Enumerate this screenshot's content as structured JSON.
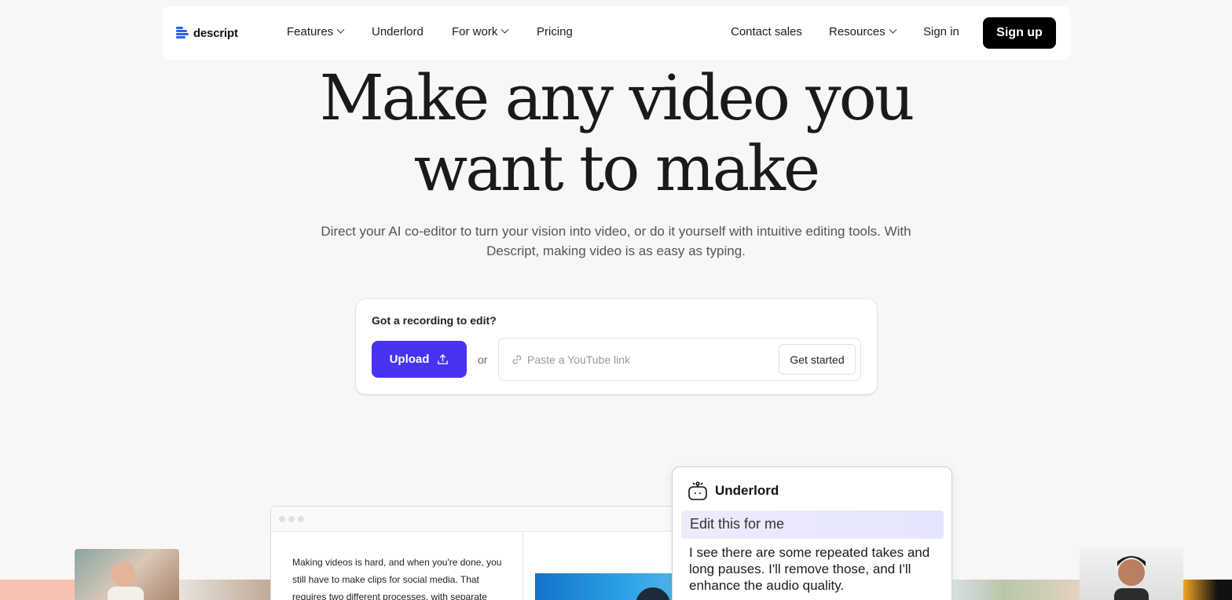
{
  "nav": {
    "brand": "descript",
    "brand_color": "#2862f0",
    "items_left": [
      {
        "label": "Features",
        "has_dropdown": true
      },
      {
        "label": "Underlord",
        "has_dropdown": false
      },
      {
        "label": "For work",
        "has_dropdown": true
      },
      {
        "label": "Pricing",
        "has_dropdown": false
      }
    ],
    "items_right": [
      {
        "label": "Contact sales",
        "has_dropdown": false
      },
      {
        "label": "Resources",
        "has_dropdown": true
      },
      {
        "label": "Sign in",
        "has_dropdown": false
      }
    ],
    "signup_label": "Sign up"
  },
  "hero": {
    "title_line1": "Make any video you",
    "title_line2": "want to make",
    "subtitle": "Direct your AI co-editor to turn your vision into video, or do it yourself with intuitive editing tools. With Descript, making video is as easy as typing."
  },
  "upload_card": {
    "label": "Got a recording to edit?",
    "upload_label": "Upload",
    "or_label": "or",
    "link_placeholder": "Paste a YouTube link",
    "get_started_label": "Get started",
    "accent_color": "#4733f0"
  },
  "showcase": {
    "editor_text": "Making videos is hard, and when you're done, you still have to make clips for social media. That requires two different processes, with separate",
    "underlord_title": "Underlord",
    "underlord_prompt": "Edit this for me",
    "underlord_reply": "I see there are some repeated takes and long pauses. I'll remove those, and I'll enhance the audio quality."
  }
}
